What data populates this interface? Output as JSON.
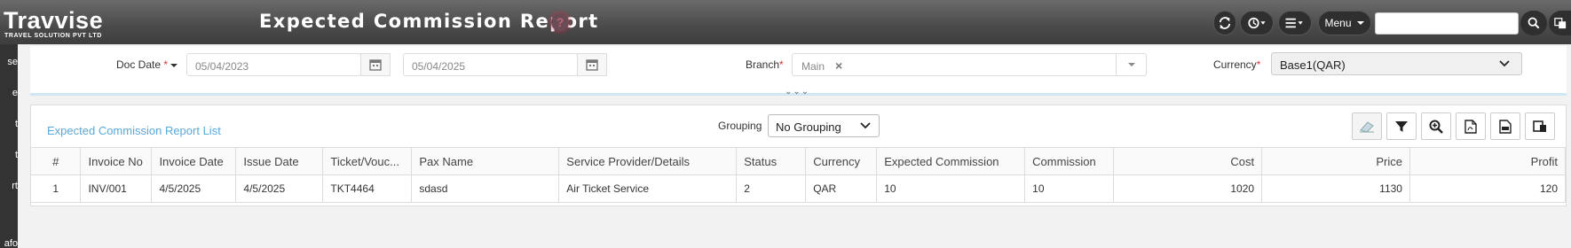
{
  "header": {
    "logo_text": "Travvise",
    "logo_subtitle": "TRAVEL SOLUTION PVT LTD",
    "title": "Expected Commission Report",
    "help_icon_glyph": "?",
    "menu_label": "Menu",
    "search_value": "",
    "icons": [
      "refresh-icon",
      "history-icon",
      "list-icon",
      "search-icon",
      "language-icon"
    ]
  },
  "sidebar": {
    "items": [
      "se",
      "e",
      "t",
      "t",
      "rt",
      "afo"
    ]
  },
  "filters": {
    "doc_date_label": "Doc Date",
    "required_mark": "*",
    "date_from": "05/04/2023",
    "date_to": "05/04/2025",
    "branch_label": "Branch",
    "branch_value": "Main",
    "branch_clear": "×",
    "currency_label": "Currency",
    "currency_value": "Base1(QAR)",
    "expand_glyph": "⌄⌄⌄"
  },
  "list": {
    "title": "Expected Commission Report List",
    "grouping_label": "Grouping",
    "grouping_value": "No Grouping",
    "columns": [
      "#",
      "Invoice No",
      "Invoice Date",
      "Issue Date",
      "Ticket/Vouc...",
      "Pax Name",
      "Service Provider/Details",
      "Status",
      "Currency",
      "Expected Commission",
      "Commission",
      "Cost",
      "Price",
      "Profit"
    ],
    "rows": [
      [
        "1",
        "INV/001",
        "4/5/2025",
        "4/5/2025",
        "TKT4464",
        "sdasd",
        "Air Ticket Service",
        "2",
        "QAR",
        "10",
        "10",
        "1020",
        "1130",
        "120"
      ]
    ]
  },
  "colors": {
    "accent": "#5aa9d9",
    "header_bg": "#4a4a4a",
    "required": "#dd3333"
  }
}
